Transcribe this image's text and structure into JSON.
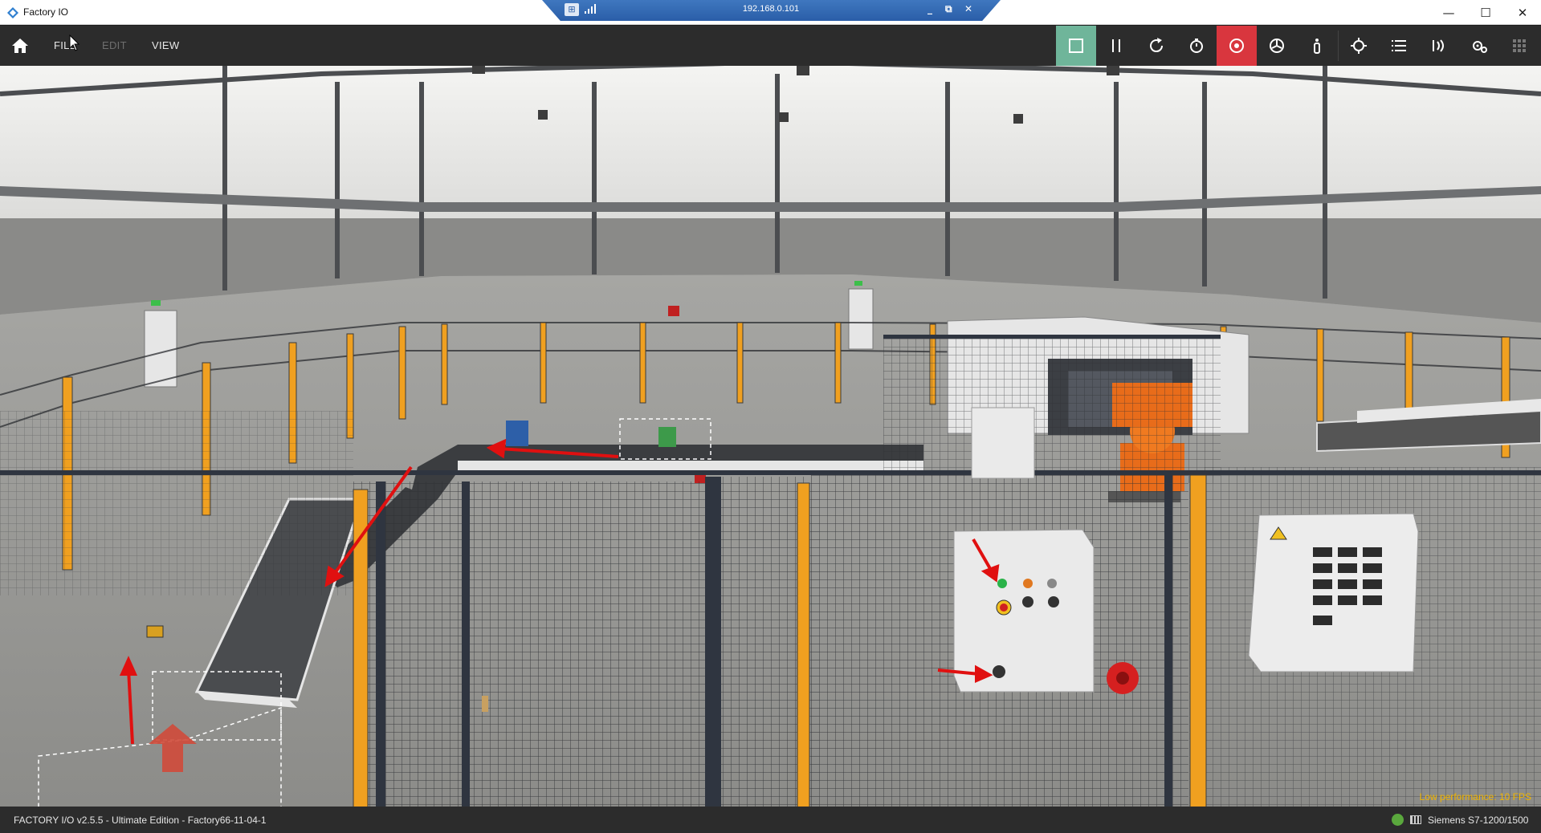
{
  "window": {
    "title": "Factory IO",
    "minimize": "—",
    "maximize": "☐",
    "close": "✕"
  },
  "remote": {
    "host": "192.168.0.101",
    "pin": "⊞",
    "controls": [
      "_",
      "⧉",
      "✕"
    ]
  },
  "menu": {
    "home_icon": "home-icon",
    "items": [
      {
        "label": "FILE",
        "enabled": true
      },
      {
        "label": "EDIT",
        "enabled": false
      },
      {
        "label": "VIEW",
        "enabled": true
      }
    ]
  },
  "toolbar": {
    "tools": [
      {
        "icon": "stop-icon",
        "state": "active",
        "color": "#6fb59a"
      },
      {
        "icon": "pause-icon",
        "state": "normal"
      },
      {
        "icon": "reset-icon",
        "state": "normal"
      },
      {
        "icon": "timer-icon",
        "state": "normal"
      },
      {
        "icon": "driver-icon",
        "state": "active",
        "color": "#d9363e"
      },
      {
        "icon": "fan-icon",
        "state": "normal"
      },
      {
        "icon": "figure-icon",
        "state": "normal"
      },
      {
        "icon": "crosshair-icon",
        "state": "normal"
      },
      {
        "icon": "list-icon",
        "state": "normal"
      },
      {
        "icon": "sensor-icon",
        "state": "normal"
      },
      {
        "icon": "settings-icon",
        "state": "normal"
      },
      {
        "icon": "grid-icon",
        "state": "disabled"
      }
    ]
  },
  "scene": {
    "perf_warning": "Low performance: 10 FPS",
    "accent_orange": "#f0a020",
    "arrow_color": "#e01010"
  },
  "status": {
    "left": "FACTORY I/O v2.5.5 - Ultimate Edition - Factory66-11-04-1",
    "plc": "Siemens S7-1200/1500",
    "ok_color": "#5aa83d"
  }
}
